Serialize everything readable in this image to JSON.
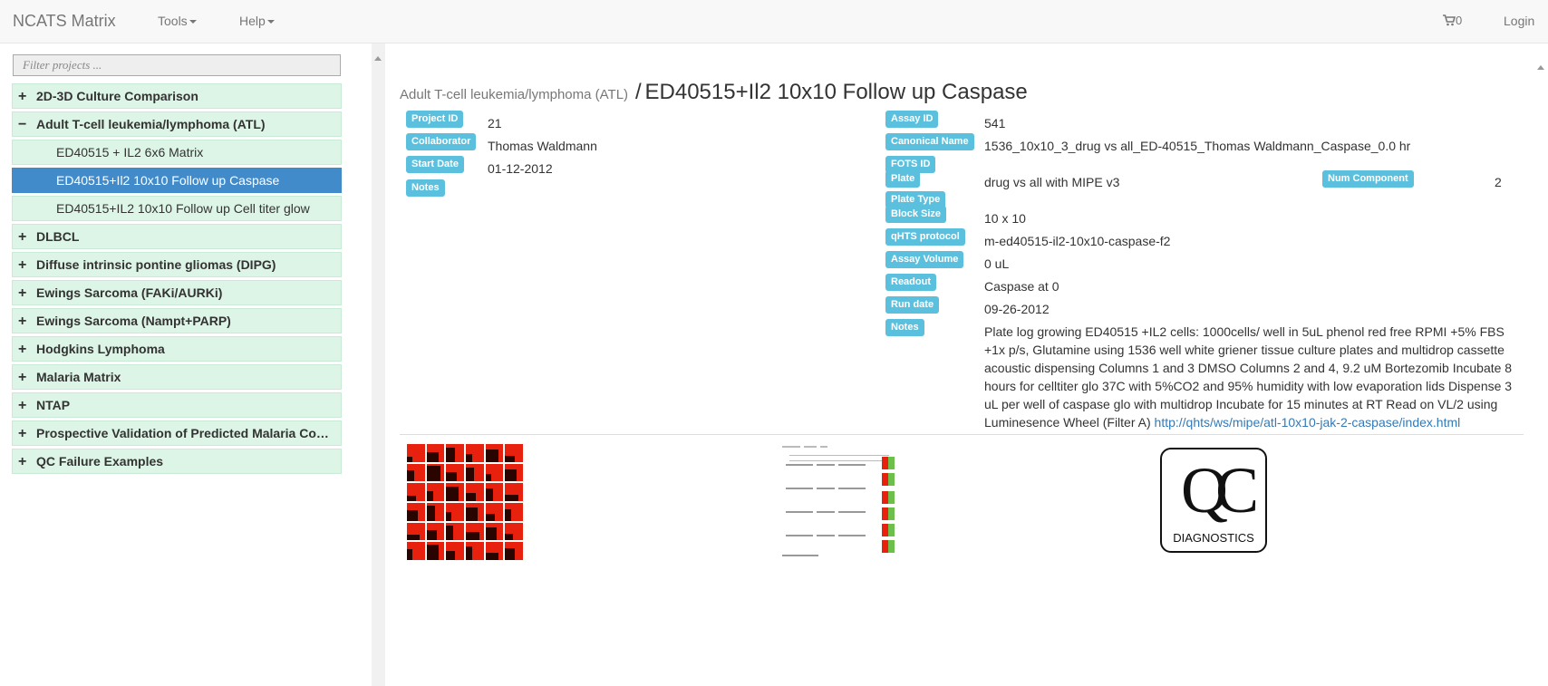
{
  "navbar": {
    "brand": "NCATS Matrix",
    "tools_label": "Tools",
    "help_label": "Help",
    "cart_count": "0",
    "login_label": "Login"
  },
  "sidebar": {
    "filter_placeholder": "Filter projects ...",
    "items": [
      {
        "sign": "+",
        "label": "2D-3D Culture Comparison"
      },
      {
        "sign": "−",
        "label": "Adult T-cell leukemia/lymphoma (ATL)"
      },
      {
        "label": "ED40515 + IL2 6x6 Matrix"
      },
      {
        "label": "ED40515+Il2 10x10 Follow up Caspase"
      },
      {
        "label": "ED40515+IL2 10x10 Follow up Cell titer glow"
      },
      {
        "sign": "+",
        "label": "DLBCL"
      },
      {
        "sign": "+",
        "label": "Diffuse intrinsic pontine gliomas (DIPG)"
      },
      {
        "sign": "+",
        "label": "Ewings Sarcoma (FAKi/AURKi)"
      },
      {
        "sign": "+",
        "label": "Ewings Sarcoma (Nampt+PARP)"
      },
      {
        "sign": "+",
        "label": "Hodgkins Lymphoma"
      },
      {
        "sign": "+",
        "label": "Malaria Matrix"
      },
      {
        "sign": "+",
        "label": "NTAP"
      },
      {
        "sign": "+",
        "label": "Prospective Validation of Predicted Malaria Co…"
      },
      {
        "sign": "+",
        "label": "QC Failure Examples"
      }
    ]
  },
  "main": {
    "breadcrumb_parent": "Adult T-cell leukemia/lymphoma (ATL)",
    "breadcrumb_sep": "/",
    "title": "ED40515+Il2 10x10 Follow up Caspase",
    "project": {
      "project_id_label": "Project ID",
      "project_id": "21",
      "collaborator_label": "Collaborator",
      "collaborator": "Thomas Waldmann",
      "start_date_label": "Start Date",
      "start_date": "01-12-2012",
      "notes_label": "Notes"
    },
    "assay": {
      "assay_id_label": "Assay ID",
      "assay_id": "541",
      "canonical_name_label": "Canonical Name",
      "canonical_name": "1536_10x10_3_drug vs all_ED-40515_Thomas Waldmann_Caspase_0.0 hr",
      "fots_id_label": "FOTS ID",
      "plate_label": "Plate",
      "plate": "drug vs all with MIPE v3",
      "num_component_label": "Num Component",
      "num_component": "2",
      "plate_type_label": "Plate Type",
      "block_size_label": "Block Size",
      "block_size": "10 x 10",
      "qhts_protocol_label": "qHTS protocol",
      "qhts_protocol": "m-ed40515-il2-10x10-caspase-f2",
      "assay_volume_label": "Assay Volume",
      "assay_volume": "0 uL",
      "readout_label": "Readout",
      "readout": "Caspase at 0",
      "run_date_label": "Run date",
      "run_date": "09-26-2012",
      "notes_label": "Notes",
      "notes": "Plate log growing ED40515 +IL2 cells: 1000cells/ well in 5uL phenol red free RPMI +5% FBS +1x p/s, Glutamine using 1536 well white griener tissue culture plates and multidrop cassette acoustic dispensing Columns 1 and 3 DMSO Columns 2 and 4, 9.2 uM Bortezomib Incubate 8 hours for celltiter glo 37C with 5%CO2 and 95% humidity with low evaporation lids Dispense 3 uL per well of caspase glo with multidrop Incubate for 15 minutes at RT Read on VL/2 using Luminesence Wheel (Filter A)",
      "notes_link": "http://qhts/ws/mipe/atl-10x10-jak-2-caspase/index.html"
    },
    "thumbnails": {
      "qc_mark": "QC",
      "qc_text": "DIAGNOSTICS"
    }
  },
  "colors": {
    "label_bg": "#5bc0de",
    "tree_bg": "#ddf5e6",
    "selected_bg": "#428bca",
    "link": "#337ab7",
    "heatmap_red": "#e8210e"
  }
}
